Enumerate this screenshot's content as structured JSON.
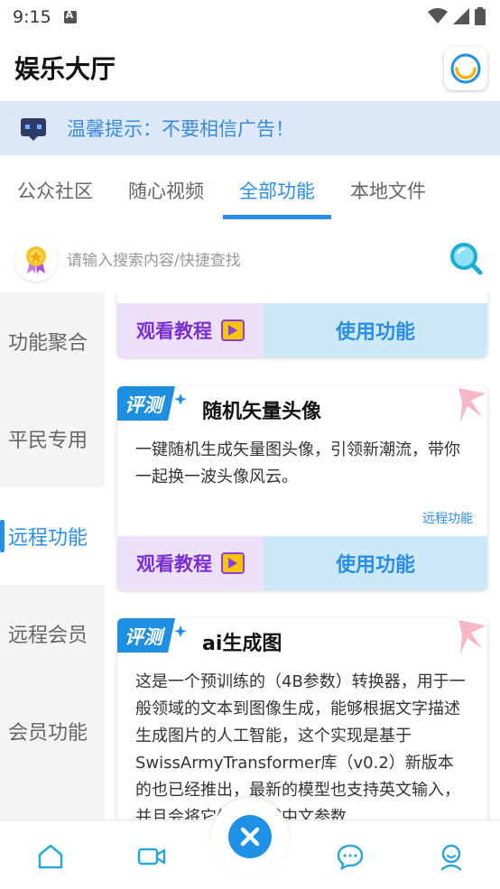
{
  "status_bar": {
    "time": "9:15"
  },
  "app_bar": {
    "title": "娱乐大厅"
  },
  "tip_banner": {
    "text": "温馨提示：不要相信广告！"
  },
  "tabs": [
    {
      "label": "公众社区"
    },
    {
      "label": "随心视频"
    },
    {
      "label": "全部功能",
      "active": true
    },
    {
      "label": "本地文件"
    }
  ],
  "search": {
    "placeholder": "请输入搜索内容/快捷查找"
  },
  "side_nav": [
    {
      "label": "功能聚合"
    },
    {
      "label": "平民专用"
    },
    {
      "label": "远程功能",
      "active": true
    },
    {
      "label": "远程会员"
    },
    {
      "label": "会员功能"
    }
  ],
  "cards": [
    {
      "watch_label": "观看教程",
      "use_label": "使用功能"
    },
    {
      "ribbon": "评测",
      "title": "随机矢量头像",
      "description": "一键随机生成矢量图头像，引领新潮流，带你一起换一波头像风云。",
      "tag": "远程功能",
      "watch_label": "观看教程",
      "use_label": "使用功能"
    },
    {
      "ribbon": "评测",
      "title": "ai生成图",
      "description": "这是一个预训练的（4B参数）转换器，用于一般领域的文本到图像生成，能够根据文字描述生成图片的人工智能，这个实现是基于SwissArmyTransformer库（v0.2）新版本的也已经推出，最新的模型也支持英文输入，并且会将它们翻译成中文参数"
    }
  ],
  "colors": {
    "accent": "#2a8ee8",
    "tip_bg": "#dde9fb",
    "watch_bg": "#ece0fa",
    "use_bg": "#cde9f8"
  }
}
